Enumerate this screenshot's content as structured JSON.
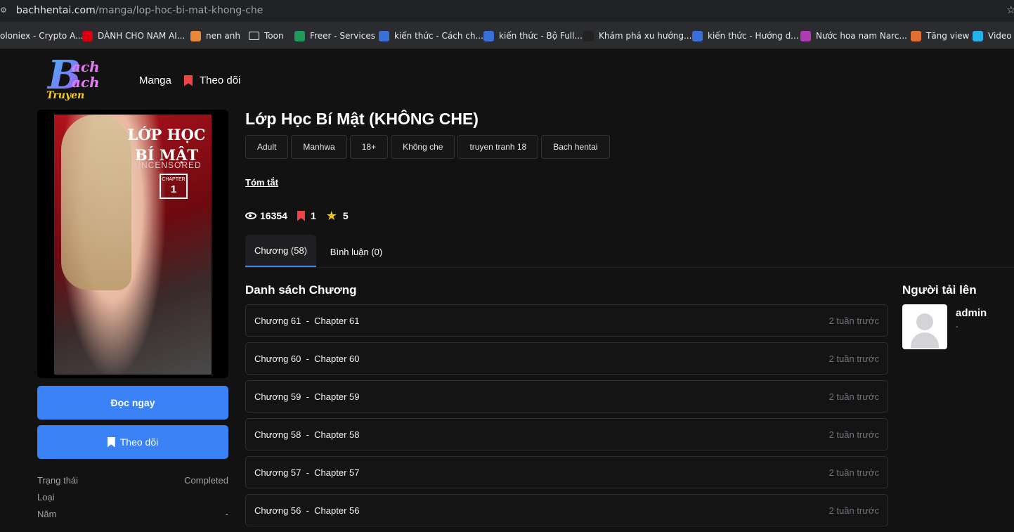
{
  "browser": {
    "url_host": "bachhentai.com",
    "url_path": "/manga/lop-hoc-bi-mat-khong-che",
    "bookmarks": [
      {
        "label": "oloniex - Crypto A...",
        "color": "#2a8a6a"
      },
      {
        "label": "DÀNH CHO NAM AI...",
        "color": "#d60012"
      },
      {
        "label": "nen anh",
        "color": "#e8873a"
      },
      {
        "label": "Toon",
        "color": "folder"
      },
      {
        "label": "Freer - Services",
        "color": "#1e9b5c"
      },
      {
        "label": "kiến thức - Cách ch...",
        "color": "#3a6fd8"
      },
      {
        "label": "kiến thức - Bộ Full...",
        "color": "#3a6fd8"
      },
      {
        "label": "Khám phá xu hướng...",
        "color": "#222222"
      },
      {
        "label": "kiến thức - Hướng d...",
        "color": "#3a6fd8"
      },
      {
        "label": "Nước hoa nam Narc...",
        "color": "#b03ab0"
      },
      {
        "label": "Tăng view",
        "color": "#e07030"
      },
      {
        "label": "Video E",
        "color": "#2ab0e8"
      }
    ]
  },
  "nav": {
    "logo_line1": "ach",
    "logo_line2": "ach",
    "logo_line3": "Truyen",
    "manga": "Manga",
    "follow": "Theo dõi"
  },
  "manga": {
    "title": "Lớp Học Bí Mật (KHÔNG CHE)",
    "cover_title": "LỚP HỌC BÍ MẬT",
    "cover_subtitle": "UNCENSORED",
    "cover_chapter_label": "CHAPTER",
    "cover_chapter_number": "1",
    "tags": [
      "Adult",
      "Manhwa",
      "18+",
      "Không che",
      "truyen tranh 18",
      "Bach hentai"
    ],
    "summary_label": "Tóm tắt",
    "views": "16354",
    "follows": "1",
    "rating": "5",
    "read_button": "Đọc ngay",
    "follow_button": "Theo dõi",
    "meta": [
      {
        "label": "Trạng thái",
        "value": "Completed"
      },
      {
        "label": "Loại",
        "value": ""
      },
      {
        "label": "Năm",
        "value": "-"
      }
    ]
  },
  "tabs": {
    "chapters": "Chương (58)",
    "comments": "Bình luận (0)"
  },
  "chapter_list": {
    "title": "Danh sách Chương",
    "items": [
      {
        "name": "Chương 61  -  Chapter 61",
        "time": "2 tuần trước"
      },
      {
        "name": "Chương 60  -  Chapter 60",
        "time": "2 tuần trước"
      },
      {
        "name": "Chương 59  -  Chapter 59",
        "time": "2 tuần trước"
      },
      {
        "name": "Chương 58  -  Chapter 58",
        "time": "2 tuần trước"
      },
      {
        "name": "Chương 57  -  Chapter 57",
        "time": "2 tuần trước"
      },
      {
        "name": "Chương 56  -  Chapter 56",
        "time": "2 tuần trước"
      }
    ]
  },
  "uploader": {
    "title": "Người tải lên",
    "name": "admin",
    "sub": "-"
  },
  "colors": {
    "accent": "#3b82f6",
    "bookmark": "#ef4444",
    "star": "#f5c518",
    "background": "#121212"
  }
}
